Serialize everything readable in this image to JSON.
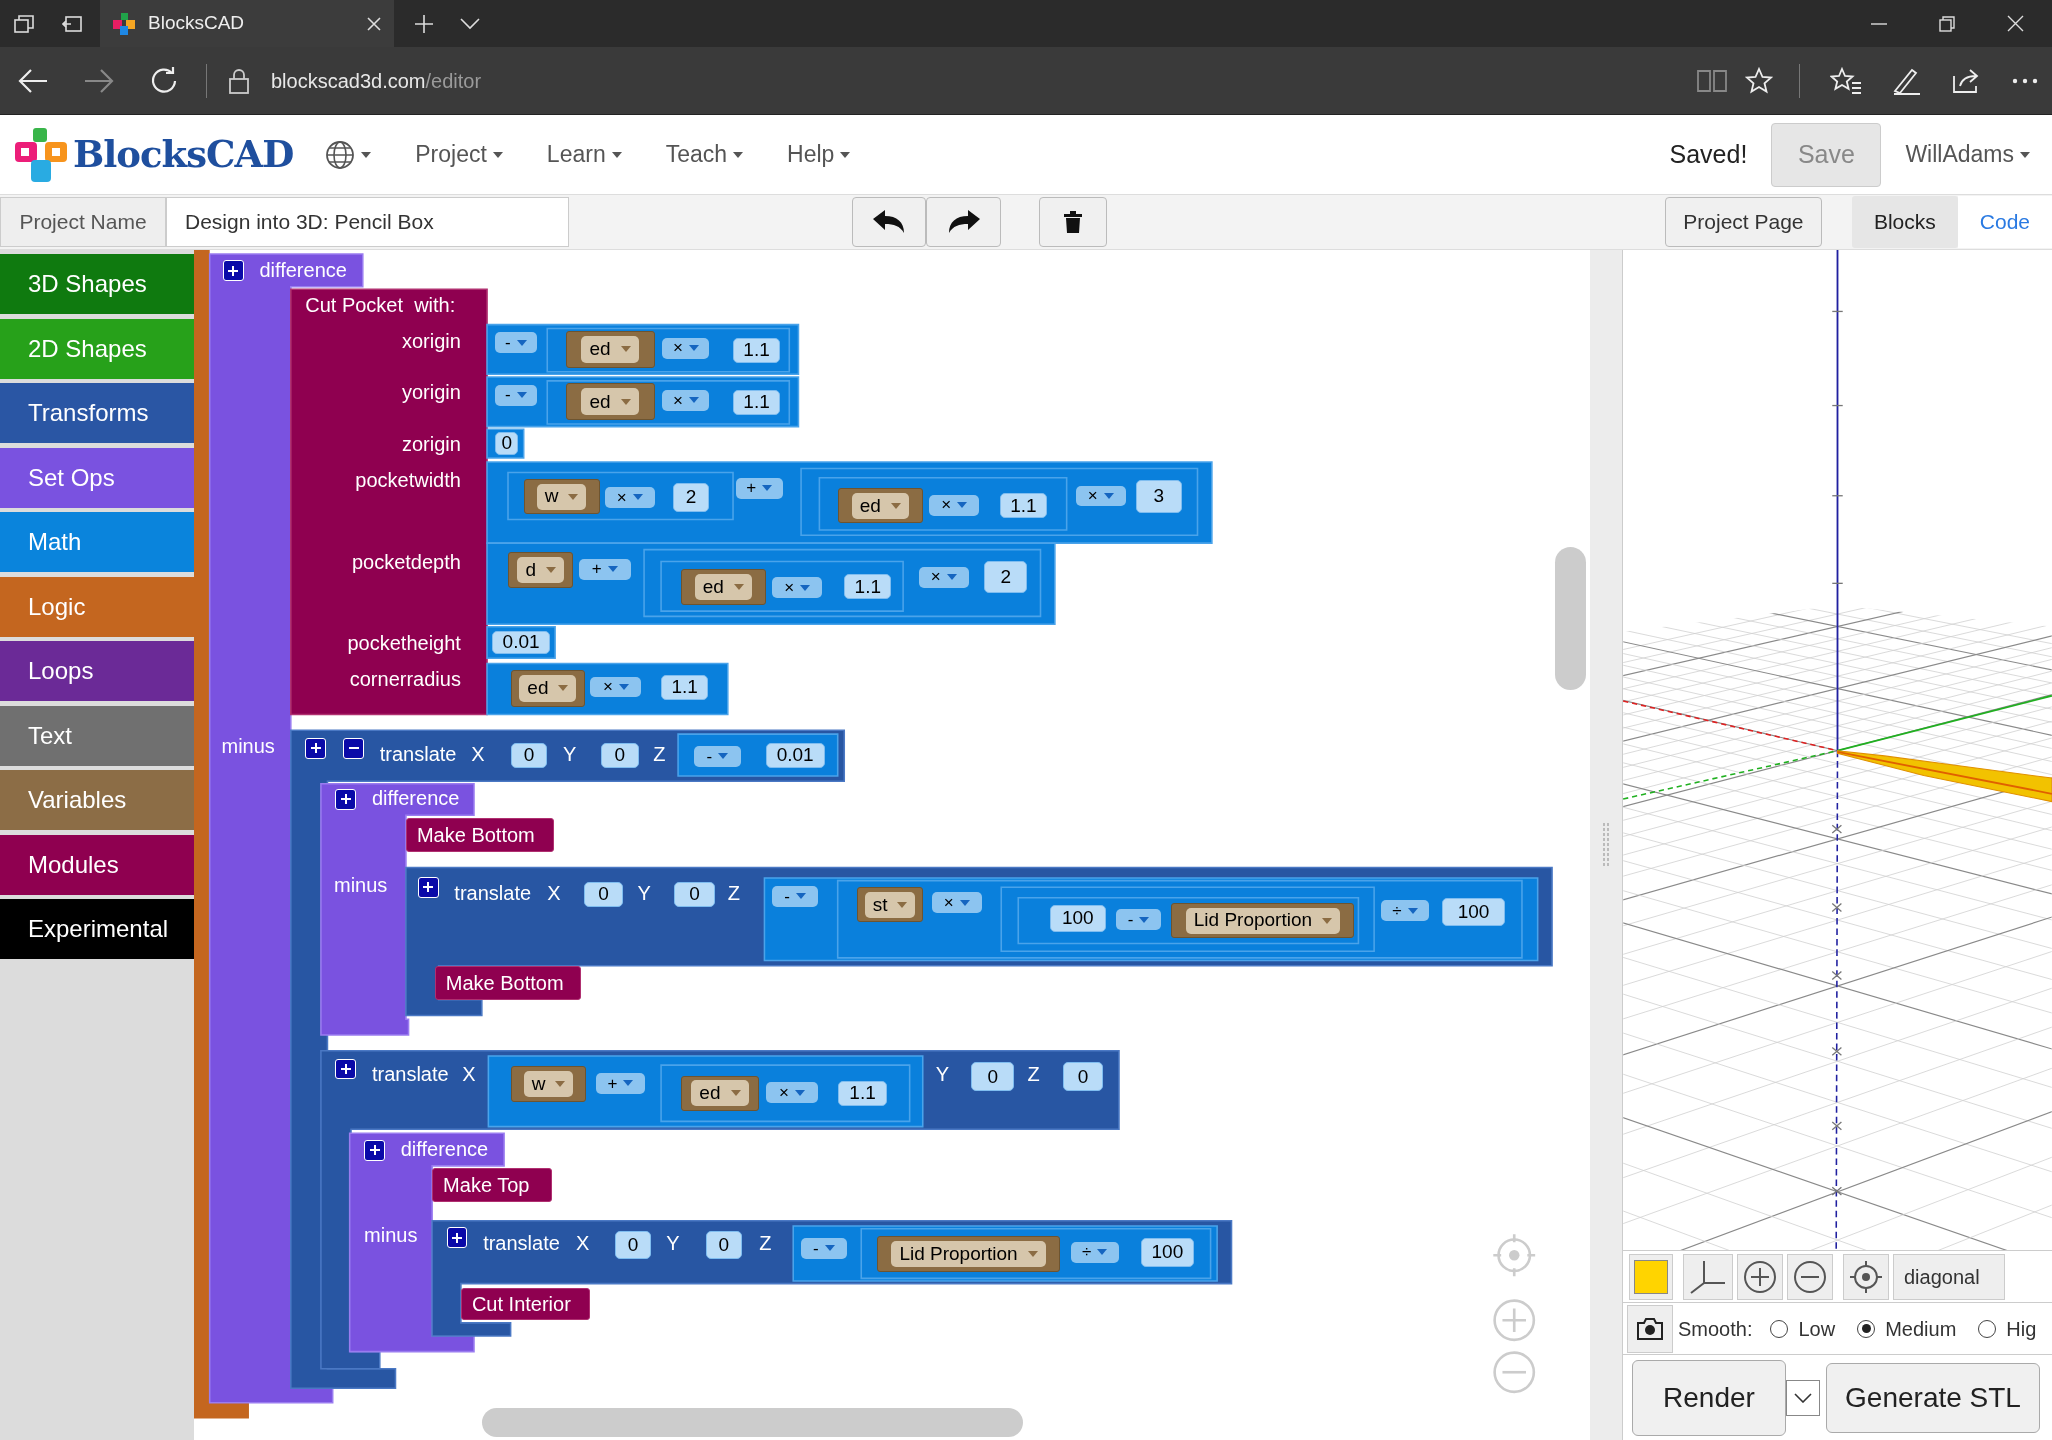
{
  "browser": {
    "tab_title": "BlocksCAD",
    "url_host": "blockscad3d.com",
    "url_path": "/editor"
  },
  "navbar": {
    "logo": "BlocksCAD",
    "menus": [
      "Project",
      "Learn",
      "Teach",
      "Help"
    ],
    "status": "Saved!",
    "save_button": "Save",
    "user_menu": "WillAdams"
  },
  "toolbar": {
    "project_name_label": "Project Name",
    "project_name": "Design into 3D: Pencil Box",
    "project_page_button": "Project Page",
    "view_tabs": [
      {
        "label": "Blocks",
        "selected": true
      },
      {
        "label": "Code",
        "selected": false
      }
    ]
  },
  "categories": [
    {
      "label": "3D Shapes",
      "color": "#0f7a0f"
    },
    {
      "label": "2D Shapes",
      "color": "#27a11a"
    },
    {
      "label": "Transforms",
      "color": "#2a56a4"
    },
    {
      "label": "Set Ops",
      "color": "#7a52e0"
    },
    {
      "label": "Math",
      "color": "#0a84dc"
    },
    {
      "label": "Logic",
      "color": "#c4661f"
    },
    {
      "label": "Loops",
      "color": "#6b2a97"
    },
    {
      "label": "Text",
      "color": "#707070"
    },
    {
      "label": "Variables",
      "color": "#8c6d46"
    },
    {
      "label": "Modules",
      "color": "#8f0050"
    },
    {
      "label": "Experimental",
      "color": "#000000"
    }
  ],
  "workspace": {
    "blocks": [
      {
        "kind": "label",
        "text": "difference"
      },
      {
        "kind": "label",
        "text": "Cut Pocket  with:"
      },
      {
        "kind": "label",
        "text": "xorigin"
      },
      {
        "kind": "dropdown",
        "text": "-"
      },
      {
        "kind": "variable",
        "text": "ed"
      },
      {
        "kind": "dropdown",
        "text": "×"
      },
      {
        "kind": "number",
        "text": "1.1"
      },
      {
        "kind": "label",
        "text": "yorigin"
      },
      {
        "kind": "dropdown",
        "text": "-"
      },
      {
        "kind": "variable",
        "text": "ed"
      },
      {
        "kind": "dropdown",
        "text": "×"
      },
      {
        "kind": "number",
        "text": "1.1"
      },
      {
        "kind": "label",
        "text": "zorigin"
      },
      {
        "kind": "number",
        "text": "0"
      },
      {
        "kind": "label",
        "text": "pocketwidth"
      },
      {
        "kind": "variable",
        "text": "w"
      },
      {
        "kind": "dropdown",
        "text": "×"
      },
      {
        "kind": "number",
        "text": "2"
      },
      {
        "kind": "dropdown",
        "text": "+"
      },
      {
        "kind": "variable",
        "text": "ed"
      },
      {
        "kind": "dropdown",
        "text": "×"
      },
      {
        "kind": "number",
        "text": "1.1"
      },
      {
        "kind": "dropdown",
        "text": "×"
      },
      {
        "kind": "number",
        "text": "3"
      },
      {
        "kind": "label",
        "text": "pocketdepth"
      },
      {
        "kind": "variable",
        "text": "d"
      },
      {
        "kind": "dropdown",
        "text": "+"
      },
      {
        "kind": "variable",
        "text": "ed"
      },
      {
        "kind": "dropdown",
        "text": "×"
      },
      {
        "kind": "number",
        "text": "1.1"
      },
      {
        "kind": "dropdown",
        "text": "×"
      },
      {
        "kind": "number",
        "text": "2"
      },
      {
        "kind": "label",
        "text": "pocketheight"
      },
      {
        "kind": "number",
        "text": "0.01"
      },
      {
        "kind": "label",
        "text": "cornerradius"
      },
      {
        "kind": "variable",
        "text": "ed"
      },
      {
        "kind": "dropdown",
        "text": "×"
      },
      {
        "kind": "number",
        "text": "1.1"
      },
      {
        "kind": "label",
        "text": "minus"
      },
      {
        "kind": "label",
        "text": "translate"
      },
      {
        "kind": "label",
        "text": "X"
      },
      {
        "kind": "number",
        "text": "0"
      },
      {
        "kind": "label",
        "text": "Y"
      },
      {
        "kind": "number",
        "text": "0"
      },
      {
        "kind": "label",
        "text": "Z"
      },
      {
        "kind": "dropdown",
        "text": "-"
      },
      {
        "kind": "number",
        "text": "0.01"
      },
      {
        "kind": "label",
        "text": "difference"
      },
      {
        "kind": "module",
        "text": "Make Bottom"
      },
      {
        "kind": "label",
        "text": "minus"
      },
      {
        "kind": "label",
        "text": "translate"
      },
      {
        "kind": "label",
        "text": "X"
      },
      {
        "kind": "number",
        "text": "0"
      },
      {
        "kind": "label",
        "text": "Y"
      },
      {
        "kind": "number",
        "text": "0"
      },
      {
        "kind": "label",
        "text": "Z"
      },
      {
        "kind": "dropdown",
        "text": "-"
      },
      {
        "kind": "variable",
        "text": "st"
      },
      {
        "kind": "dropdown",
        "text": "×"
      },
      {
        "kind": "number",
        "text": "100"
      },
      {
        "kind": "dropdown",
        "text": "-"
      },
      {
        "kind": "variable",
        "text": "Lid Proportion"
      },
      {
        "kind": "dropdown",
        "text": "÷"
      },
      {
        "kind": "number",
        "text": "100"
      },
      {
        "kind": "module",
        "text": "Make Bottom"
      },
      {
        "kind": "label",
        "text": "translate"
      },
      {
        "kind": "label",
        "text": "X"
      },
      {
        "kind": "variable",
        "text": "w"
      },
      {
        "kind": "dropdown",
        "text": "+"
      },
      {
        "kind": "variable",
        "text": "ed"
      },
      {
        "kind": "dropdown",
        "text": "×"
      },
      {
        "kind": "number",
        "text": "1.1"
      },
      {
        "kind": "label",
        "text": "Y"
      },
      {
        "kind": "number",
        "text": "0"
      },
      {
        "kind": "label",
        "text": "Z"
      },
      {
        "kind": "number",
        "text": "0"
      },
      {
        "kind": "label",
        "text": "difference"
      },
      {
        "kind": "module",
        "text": "Make Top"
      },
      {
        "kind": "label",
        "text": "minus"
      },
      {
        "kind": "label",
        "text": "translate"
      },
      {
        "kind": "label",
        "text": "X"
      },
      {
        "kind": "number",
        "text": "0"
      },
      {
        "kind": "label",
        "text": "Y"
      },
      {
        "kind": "number",
        "text": "0"
      },
      {
        "kind": "label",
        "text": "Z"
      },
      {
        "kind": "dropdown",
        "text": "-"
      },
      {
        "kind": "variable",
        "text": "Lid Proportion"
      },
      {
        "kind": "dropdown",
        "text": "÷"
      },
      {
        "kind": "number",
        "text": "100"
      },
      {
        "kind": "module",
        "text": "Cut Interior"
      }
    ]
  },
  "viewer": {
    "view_preset": "diagonal",
    "smooth_label": "Smooth:",
    "smooth_options": [
      {
        "label": "Low",
        "selected": false
      },
      {
        "label": "Medium",
        "selected": true
      },
      {
        "label": "Hig",
        "selected": false
      }
    ],
    "render_button": "Render",
    "generate_button": "Generate STL"
  }
}
